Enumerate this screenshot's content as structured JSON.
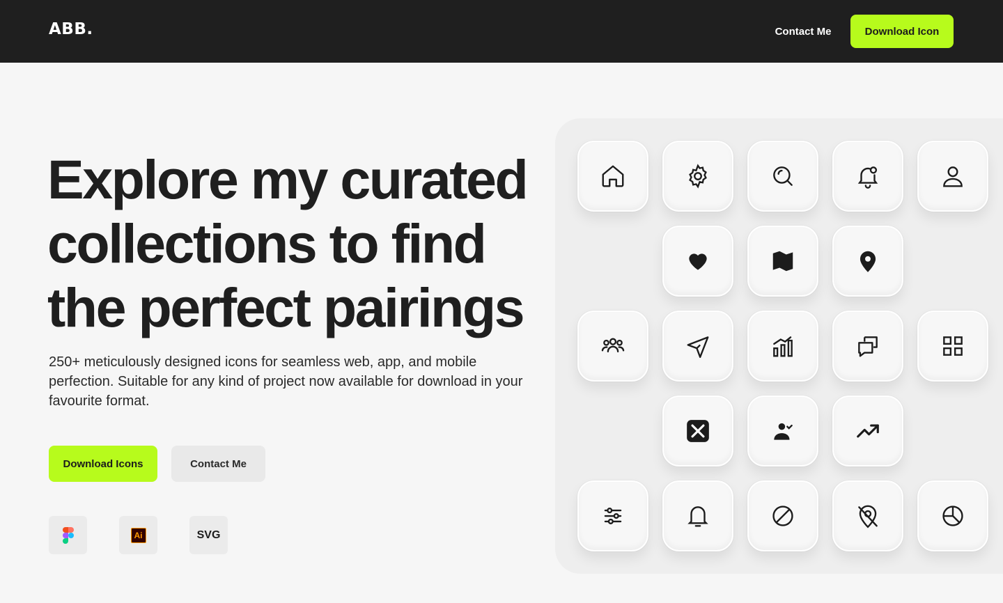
{
  "header": {
    "logo": "ABB.",
    "contact_label": "Contact Me",
    "download_label": "Download Icon"
  },
  "hero": {
    "title": "Explore my curated collections to find the perfect pairings",
    "description": "250+ meticulously designed icons for seamless web, app, and mobile perfection. Suitable for any kind of project now available for download in your favourite format.",
    "primary_label": "Download Icons",
    "secondary_label": "Contact Me"
  },
  "formats": [
    {
      "icon": "figma-icon"
    },
    {
      "icon": "illustrator-icon",
      "label": "Ai"
    },
    {
      "icon": "svg-format",
      "label": "SVG"
    }
  ],
  "icon_grid": [
    "home-icon",
    "gear-icon",
    "search-icon",
    "bell-notification-icon",
    "user-icon",
    "heart-icon",
    "map-icon",
    "location-pin-icon",
    "team-icon",
    "send-icon",
    "bar-chart-icon",
    "chat-icon",
    "grid-icon",
    "close-box-icon",
    "user-check-icon",
    "trending-up-icon",
    "sliders-icon",
    "bell-icon",
    "block-icon",
    "location-off-icon",
    "pie-chart-icon"
  ],
  "colors": {
    "accent": "#b7fb1c",
    "header_bg": "#1f1f1f",
    "page_bg": "#f6f6f6",
    "text": "#1c1c1c"
  }
}
